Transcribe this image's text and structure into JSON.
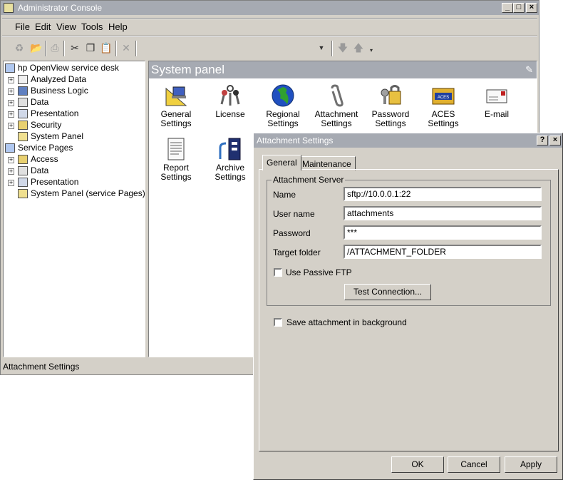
{
  "main_window": {
    "title": "Administrator Console",
    "menu": [
      "File",
      "Edit",
      "View",
      "Tools",
      "Help"
    ],
    "status": "Attachment Settings"
  },
  "tree": {
    "root1": "hp OpenView service desk",
    "root1_items": [
      "Analyzed Data",
      "Business Logic",
      "Data",
      "Presentation",
      "Security",
      "System Panel"
    ],
    "root2": "Service Pages",
    "root2_items": [
      "Access",
      "Data",
      "Presentation",
      "System Panel (service Pages)"
    ]
  },
  "panel": {
    "title": "System panel",
    "items": [
      {
        "line1": "General",
        "line2": "Settings",
        "icon": "general-settings-icon"
      },
      {
        "line1": "License",
        "line2": "",
        "icon": "license-keys-icon"
      },
      {
        "line1": "Regional",
        "line2": "Settings",
        "icon": "globe-icon"
      },
      {
        "line1": "Attachment",
        "line2": "Settings",
        "icon": "paperclip-icon"
      },
      {
        "line1": "Password",
        "line2": "Settings",
        "icon": "password-keys-icon"
      },
      {
        "line1": "ACES Settings",
        "line2": "",
        "icon": "aces-icon"
      },
      {
        "line1": "E-mail",
        "line2": "",
        "icon": "email-icon"
      },
      {
        "line1": "Report",
        "line2": "Settings",
        "icon": "report-icon"
      },
      {
        "line1": "Archive",
        "line2": "Settings",
        "icon": "archive-icon"
      }
    ]
  },
  "dialog": {
    "title": "Attachment Settings",
    "tabs": [
      "General",
      "Maintenance"
    ],
    "group_title": "Attachment Server",
    "name_label": "Name",
    "name_value": "sftp://10.0.0.1:22",
    "username_label": "User name",
    "username_value": "attachments",
    "password_label": "Password",
    "password_value": "***",
    "target_label": "Target folder",
    "target_value": "/ATTACHMENT_FOLDER",
    "passive_ftp_label": "Use Passive FTP",
    "test_button": "Test Connection...",
    "background_label": "Save attachment in background",
    "ok": "OK",
    "cancel": "Cancel",
    "apply": "Apply"
  }
}
